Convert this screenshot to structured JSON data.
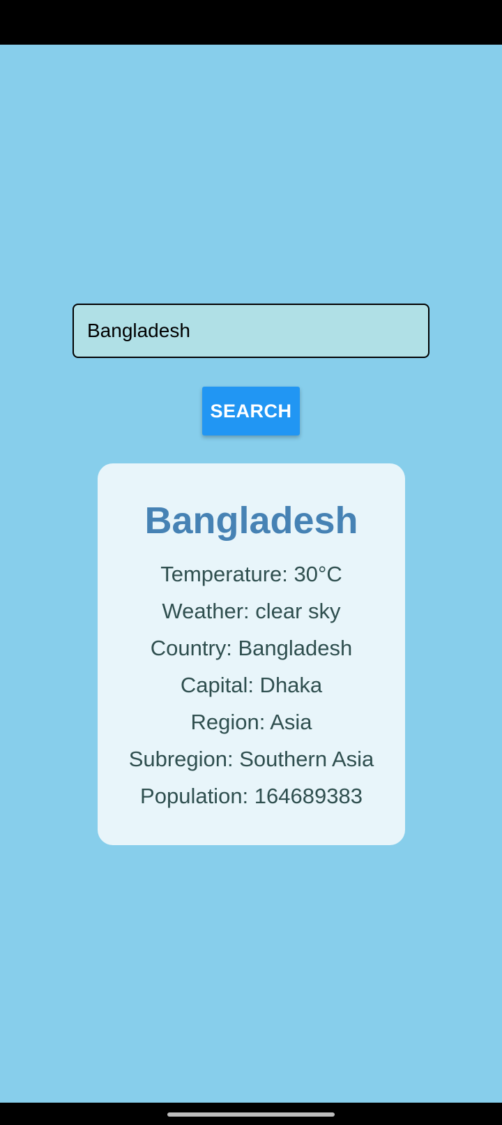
{
  "search": {
    "value": "Bangladesh",
    "button_label": "SEARCH"
  },
  "result": {
    "title": "Bangladesh",
    "temperature": "Temperature: 30°C",
    "weather": "Weather: clear sky",
    "country": "Country: Bangladesh",
    "capital": "Capital: Dhaka",
    "region": "Region: Asia",
    "subregion": "Subregion: Southern Asia",
    "population": "Population: 164689383"
  },
  "colors": {
    "background": "#87CEEB",
    "input_background": "#B0E0E6",
    "button": "#2196F3",
    "card_background": "#E8F5FA",
    "title": "#4682B4",
    "info_text": "#2F4F4F"
  }
}
